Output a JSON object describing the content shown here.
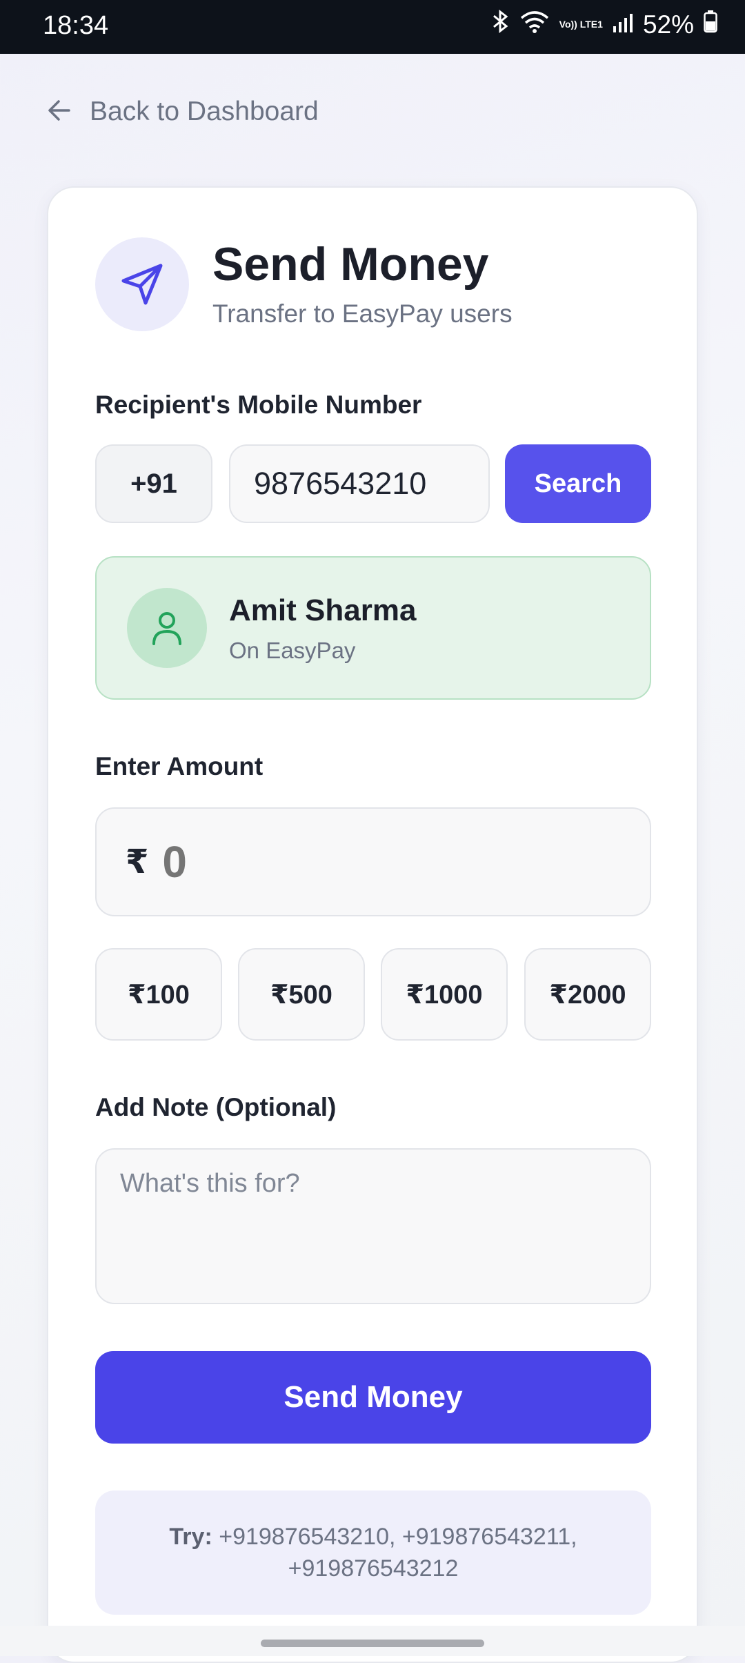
{
  "status_bar": {
    "time": "18:34",
    "network": "Vo)) LTE1",
    "battery": "52%"
  },
  "nav": {
    "back_label": "Back to Dashboard"
  },
  "header": {
    "title": "Send Money",
    "subtitle": "Transfer to EasyPay users",
    "icon": "send-icon"
  },
  "recipient_section": {
    "label": "Recipient's Mobile Number",
    "country_code": "+91",
    "phone_value": "9876543210",
    "search_label": "Search"
  },
  "recipient": {
    "name": "Amit Sharma",
    "status": "On EasyPay",
    "icon": "user-icon"
  },
  "amount_section": {
    "label": "Enter Amount",
    "currency_symbol": "₹",
    "placeholder": "0",
    "quick_amounts": [
      "₹100",
      "₹500",
      "₹1000",
      "₹2000"
    ]
  },
  "note_section": {
    "label": "Add Note (Optional)",
    "placeholder": "What's this for?"
  },
  "actions": {
    "send_label": "Send Money"
  },
  "hint": {
    "prefix": "Try:",
    "numbers": "+919876543210, +919876543211, +919876543212"
  },
  "colors": {
    "primary": "#4a44e8",
    "search_button": "#5752ec",
    "success_bg": "#e6f4ea",
    "success_icon": "#22a35a",
    "muted_text": "#6b7283"
  }
}
